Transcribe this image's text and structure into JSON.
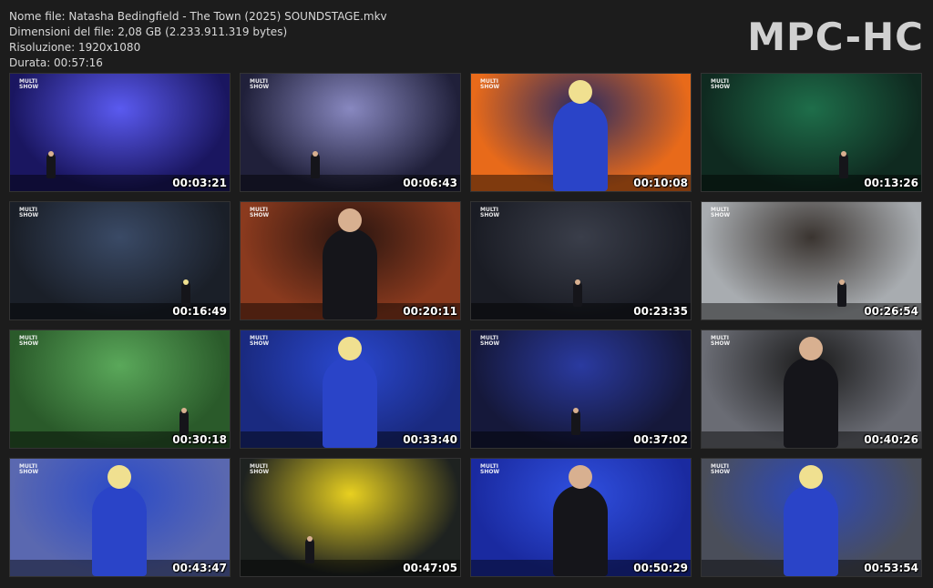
{
  "file_info": {
    "name_line": "Nome file: Natasha Bedingfield - The Town (2025) SOUNDSTAGE.mkv",
    "size_line": "Dimensioni del file: 2,08 GB (2.233.911.319 bytes)",
    "resolution_line": "Risoluzione: 1920x1080",
    "duration_line": "Durata: 00:57:16"
  },
  "logo": "MPC-HC",
  "thumbnails": [
    {
      "time": "00:03:21",
      "bg": "#1a1660",
      "accent": "#5a5af0"
    },
    {
      "time": "00:06:43",
      "bg": "#20203a",
      "accent": "#8888c0"
    },
    {
      "time": "00:10:08",
      "bg": "#e86a1a",
      "accent": "#2a2a60"
    },
    {
      "time": "00:13:26",
      "bg": "#0f2a20",
      "accent": "#1e6e4a"
    },
    {
      "time": "00:16:49",
      "bg": "#1a1f28",
      "accent": "#3a4a66"
    },
    {
      "time": "00:20:11",
      "bg": "#8a3a1e",
      "accent": "#2a1510"
    },
    {
      "time": "00:23:35",
      "bg": "#1a1c24",
      "accent": "#3a3e4a"
    },
    {
      "time": "00:26:54",
      "bg": "#a8acb0",
      "accent": "#3a3430"
    },
    {
      "time": "00:30:18",
      "bg": "#2a5a2a",
      "accent": "#5aa85a"
    },
    {
      "time": "00:33:40",
      "bg": "#1a2a80",
      "accent": "#2a48d0"
    },
    {
      "time": "00:37:02",
      "bg": "#15183a",
      "accent": "#2a3aa0"
    },
    {
      "time": "00:40:26",
      "bg": "#6a6c74",
      "accent": "#1a1a1a"
    },
    {
      "time": "00:43:47",
      "bg": "#5a68b0",
      "accent": "#2a4ac8"
    },
    {
      "time": "00:47:05",
      "bg": "#1e2220",
      "accent": "#e8d020"
    },
    {
      "time": "00:50:29",
      "bg": "#1a2aa0",
      "accent": "#3050e0"
    },
    {
      "time": "00:53:54",
      "bg": "#4a4e5a",
      "accent": "#2a48c0"
    }
  ]
}
